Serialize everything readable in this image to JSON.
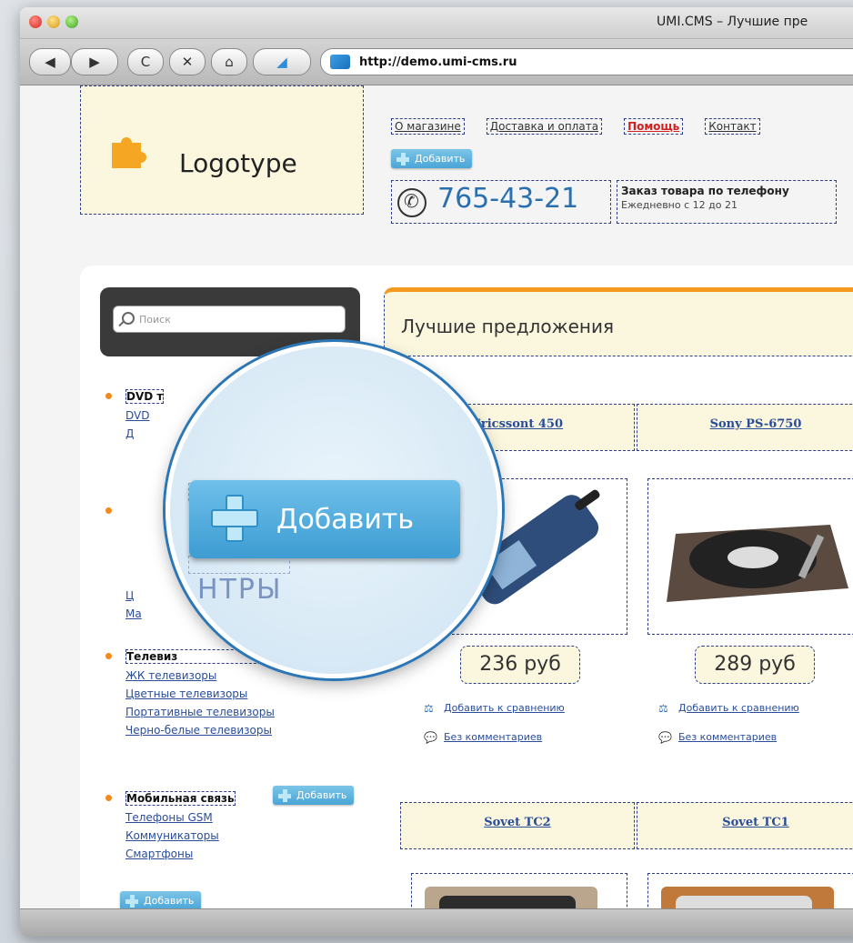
{
  "window": {
    "title": "UMI.CMS – Лучшие пре",
    "url": "http://demo.umi-cms.ru"
  },
  "toolbar": {
    "back": "◀",
    "forward": "▶",
    "reload": "C",
    "stop": "✕",
    "home": "⌂"
  },
  "header": {
    "logo_text": "Logotype",
    "menu": [
      "О магазине",
      "Доставка и оплата",
      "Помощь",
      "Контакт"
    ],
    "add_label": "Добавить",
    "phone": "765-43-21",
    "order_title": "Заказ товара по телефону",
    "order_hours": "Ежедневно с 12 до 21"
  },
  "search": {
    "placeholder": "Поиск"
  },
  "offers": {
    "title": "Лучшие предложения"
  },
  "categories": [
    {
      "head": "DVD т",
      "subs": [
        "DVD",
        "Д"
      ]
    },
    {
      "head": "",
      "subs": [
        "Ц",
        "Ма"
      ]
    },
    {
      "head": "Телевиз",
      "subs": [
        "ЖК телевизоры",
        "Цветные телевизоры",
        "Портативные телевизоры",
        "Черно-белые телевизоры"
      ]
    },
    {
      "head": "Мобильная связь",
      "subs": [
        "Телефоны GSM",
        "Коммуникаторы",
        "Смартфоны"
      ]
    }
  ],
  "products": [
    {
      "name": "Ericssont 450",
      "price": "236 руб",
      "compare": "Добавить к сравнению",
      "comments": "Без комментариев"
    },
    {
      "name": "Sony PS-6750",
      "price": "289 руб",
      "compare": "Добавить к сравнению",
      "comments": "Без комментариев"
    },
    {
      "name": "Sovet TC2"
    },
    {
      "name": "Sovet TC1"
    }
  ],
  "magnifier": {
    "button_label": "Добавить",
    "ghost_text": "НТРЫ"
  },
  "colors": {
    "accent": "#f39a1e",
    "link": "#2a4d9a",
    "add_button": "#4aa5d6",
    "highlight_bg": "#fbf7df"
  }
}
